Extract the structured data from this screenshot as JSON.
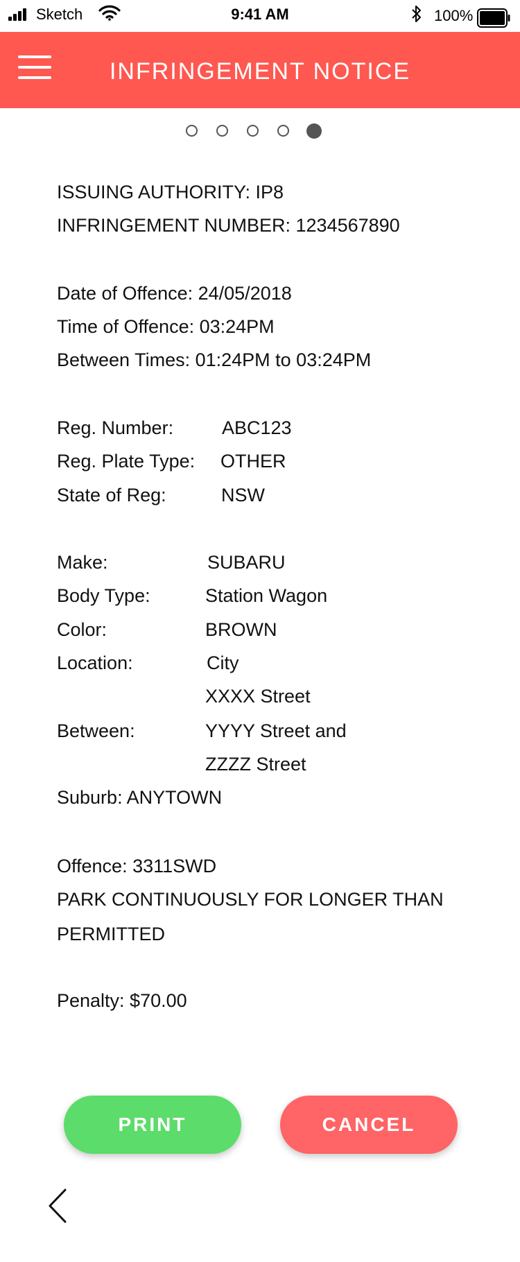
{
  "status_bar": {
    "carrier": "Sketch",
    "time": "9:41 AM",
    "battery_percent": "100%",
    "icons": [
      "signal-icon",
      "wifi-icon",
      "bluetooth-icon",
      "battery-icon"
    ]
  },
  "header": {
    "title": "INFRINGEMENT NOTICE",
    "menu_icon": "hamburger-menu-icon",
    "background_color": "#fe5850"
  },
  "pager": {
    "total_pages": 5,
    "active_page": 5
  },
  "notice": {
    "issuing_authority": "ISSUING AUTHORITY: IP8",
    "infringement_number": "INFRINGEMENT NUMBER: 1234567890",
    "date_of_offence": "Date of Offence: 24/05/2018",
    "time_of_offence": "Time of Offence: 03:24PM",
    "between_times": "Between Times: 01:24PM to 03:24PM",
    "reg_number_label": "Reg. Number:",
    "reg_number_value": "ABC123",
    "reg_plate_type_label": "Reg. Plate Type:",
    "reg_plate_type_value": "OTHER",
    "state_of_reg_label": "State of Reg:",
    "state_of_reg_value": "NSW",
    "make_label": "Make:",
    "make_value": "SUBARU",
    "body_type_label": "Body Type:",
    "body_type_value": "Station Wagon",
    "color_label": "Color:",
    "color_value": "BROWN",
    "location_label": "Location:",
    "location_line1": "City",
    "location_line2": "XXXX Street",
    "between_label": "Between:",
    "between_line1": "YYYY Street and",
    "between_line2": "ZZZZ Street",
    "suburb": "Suburb: ANYTOWN",
    "offence_code": "Offence:  3311SWD",
    "offence_desc_line1": "PARK CONTINUOUSLY FOR LONGER THAN",
    "offence_desc_line2": "PERMITTED",
    "penalty": "Penalty: $70.00"
  },
  "actions": {
    "print_label": "PRINT",
    "print_color": "#5cdc6a",
    "cancel_label": "CANCEL",
    "cancel_color": "#ff6466",
    "back_icon": "chevron-left-icon"
  }
}
